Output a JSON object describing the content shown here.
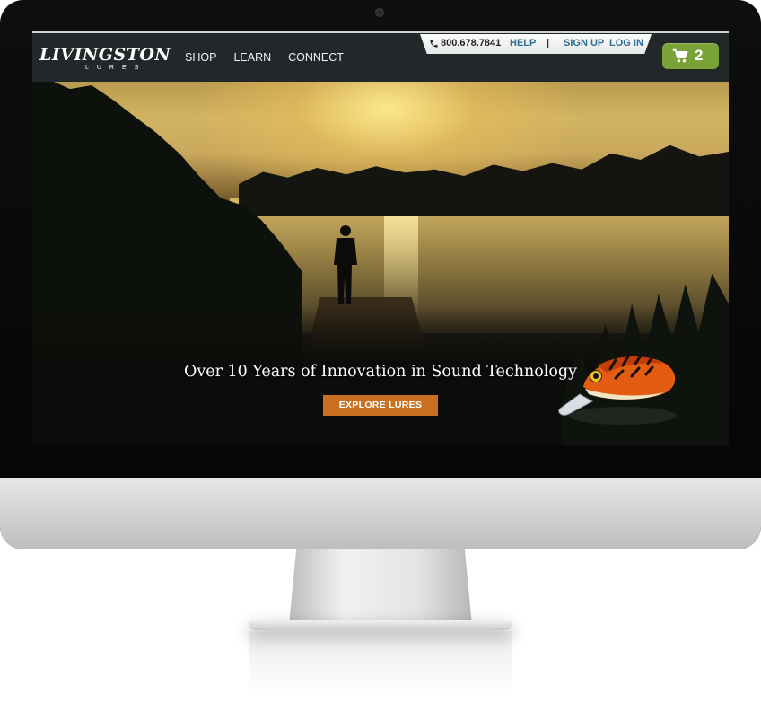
{
  "site": {
    "logo_main": "LIVINGSTON",
    "logo_sub": "LURES"
  },
  "nav": {
    "items": [
      {
        "label": "SHOP"
      },
      {
        "label": "LEARN"
      },
      {
        "label": "CONNECT"
      }
    ]
  },
  "utility": {
    "phone": "800.678.7841",
    "help": "HELP",
    "separator": "|",
    "signup": "SIGN UP",
    "login": "LOG IN"
  },
  "cart": {
    "count": "2",
    "icon": "cart-icon",
    "color": "#79a337"
  },
  "hero": {
    "headline": "Over 10 Years of Innovation in Sound Technology",
    "button_label": "EXPLORE LURES",
    "button_color": "#c9711f"
  },
  "colors": {
    "topbar": "#22282a",
    "link": "#2c6e96"
  }
}
